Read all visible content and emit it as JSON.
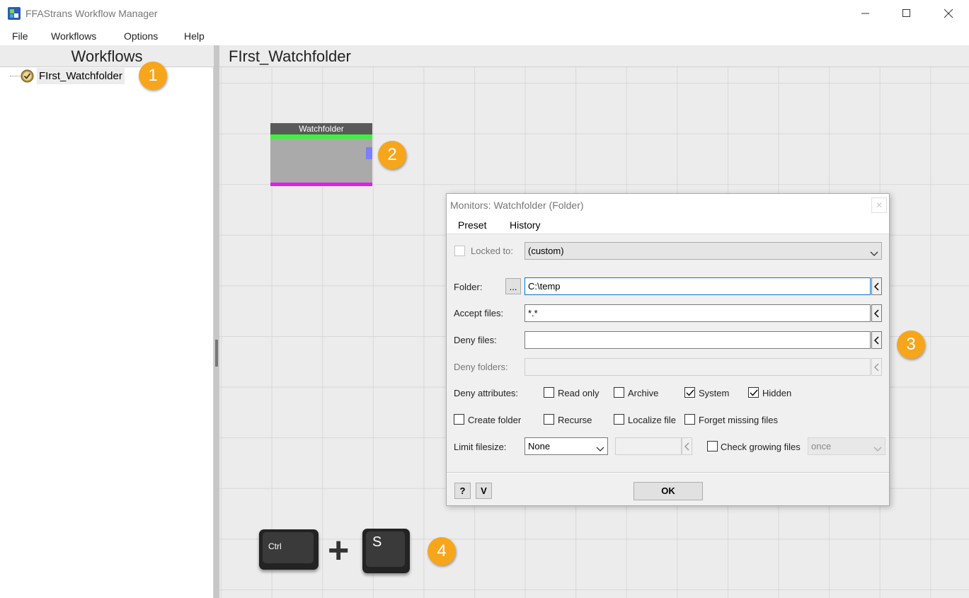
{
  "window": {
    "title": "FFAStrans Workflow Manager"
  },
  "menu": [
    "File",
    "Workflows",
    "Options",
    "Help"
  ],
  "sidebar": {
    "header": "Workflows",
    "items": [
      {
        "label": "FIrst_Watchfolder",
        "icon": "checkmark-circle-icon"
      }
    ]
  },
  "canvas": {
    "title": "FIrst_Watchfolder",
    "node": {
      "label": "Watchfolder",
      "top_color": "#3df23d",
      "bottom_color": "#e21ee2",
      "port_color": "#7d7dff"
    }
  },
  "dialog": {
    "title": "Monitors: Watchfolder (Folder)",
    "menu": [
      "Preset",
      "History"
    ],
    "locked_to": {
      "label": "Locked to:",
      "value": "(custom)",
      "checked": false
    },
    "folder": {
      "label": "Folder:",
      "browse_label": "...",
      "value": "C:\\temp"
    },
    "accept_files": {
      "label": "Accept files:",
      "value": "*.*"
    },
    "deny_files": {
      "label": "Deny files:",
      "value": ""
    },
    "deny_folders": {
      "label": "Deny folders:",
      "value": ""
    },
    "deny_attributes": {
      "label": "Deny attributes:",
      "options": [
        {
          "label": "Read only",
          "checked": false
        },
        {
          "label": "Archive",
          "checked": false
        },
        {
          "label": "System",
          "checked": true
        },
        {
          "label": "Hidden",
          "checked": true
        }
      ]
    },
    "options": [
      {
        "label": "Create folder",
        "checked": false
      },
      {
        "label": "Recurse",
        "checked": false
      },
      {
        "label": "Localize file",
        "checked": false
      },
      {
        "label": "Forget missing files",
        "checked": false
      }
    ],
    "limit_filesize": {
      "label": "Limit filesize:",
      "value": "None",
      "size_value": ""
    },
    "check_growing": {
      "label": "Check growing files",
      "checked": false,
      "value": "once"
    },
    "footer": {
      "help_label": "?",
      "version_label": "V",
      "ok_label": "OK"
    }
  },
  "badges": [
    "1",
    "2",
    "3",
    "4"
  ],
  "shortcut": {
    "key1": "Ctrl",
    "plus": "+",
    "key2": "S"
  },
  "colors": {
    "badge": "#f7a61b",
    "focus": "#0078d7"
  }
}
